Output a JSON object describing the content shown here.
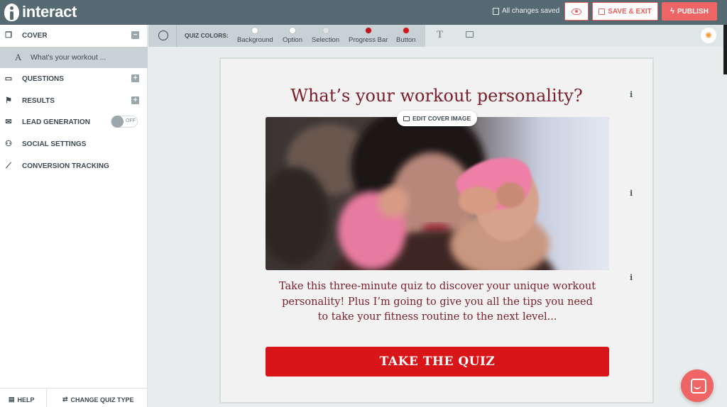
{
  "app": {
    "logo_text": "interact",
    "save_status": "All changes saved",
    "save_exit_label": "SAVE & EXIT",
    "publish_label": "PUBLISH"
  },
  "sidebar": {
    "cover": "COVER",
    "cover_sub": "What's your workout ...",
    "questions": "QUESTIONS",
    "results": "RESULTS",
    "lead_generation": "LEAD GENERATION",
    "lead_toggle": "OFF",
    "social_settings": "SOCIAL SETTINGS",
    "conversion_tracking": "CONVERSION TRACKING",
    "help": "HELP",
    "change_quiz_type": "CHANGE QUIZ TYPE"
  },
  "toolbar": {
    "quiz_colors_label": "QUIZ COLORS:",
    "swatches": [
      {
        "label": "Background",
        "color": "#ffffff"
      },
      {
        "label": "Option",
        "color": "#ffffff"
      },
      {
        "label": "Selection",
        "color": "#e4e4e4"
      },
      {
        "label": "Progress Bar",
        "color": "#c0141a"
      },
      {
        "label": "Button",
        "color": "#d8161a"
      }
    ]
  },
  "quiz": {
    "title": "What’s your workout personality?",
    "edit_cover_image": "EDIT COVER IMAGE",
    "description": "Take this three-minute quiz to discover your unique workout personality! Plus I’m going to give you all the tips you need to take your fitness routine to the next level...",
    "cta": "TAKE THE QUIZ",
    "info_glyph": "i"
  },
  "colors": {
    "topbar": "#566a74",
    "accent": "#ef6464",
    "title": "#7a1f2a",
    "button": "#d8161a"
  }
}
